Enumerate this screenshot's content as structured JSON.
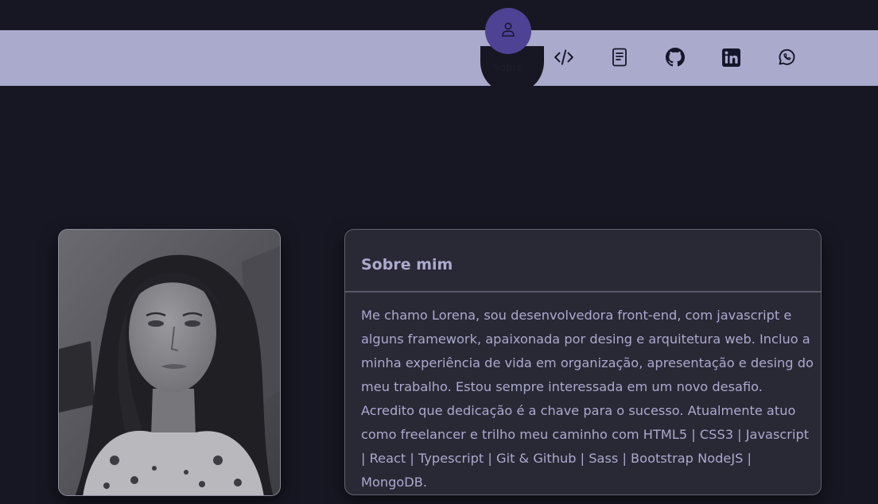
{
  "nav": {
    "active_label": "Sobre",
    "items": [
      {
        "icon": "user-icon",
        "label": "Sobre",
        "active": true
      },
      {
        "icon": "code-icon",
        "active": false
      },
      {
        "icon": "document-icon",
        "active": false
      },
      {
        "icon": "github-icon",
        "active": false
      },
      {
        "icon": "linkedin-icon",
        "active": false
      },
      {
        "icon": "whatsapp-icon",
        "active": false
      }
    ]
  },
  "about": {
    "title": "Sobre mim",
    "text": "Me chamo Lorena, sou desenvolvedora front-end, com javascript e alguns framework, apaixonada por desing e arquitetura web. Incluo a minha experiência de vida em organização, apresentação e desing do meu trabalho. Estou sempre interessada em um novo desafio. Acredito que dedicação é a chave para o sucesso. Atualmente atuo como freelancer e trilho meu caminho com HTML5 | CSS3 | Javascript | React | Typescript | Git & Github | Sass | Bootstrap NodeJS | MongoDB."
  },
  "colors": {
    "background": "#171723",
    "nav_bar": "#aaaacd",
    "accent": "#4e4294",
    "card": "#292835",
    "text": "#aaaacd"
  }
}
